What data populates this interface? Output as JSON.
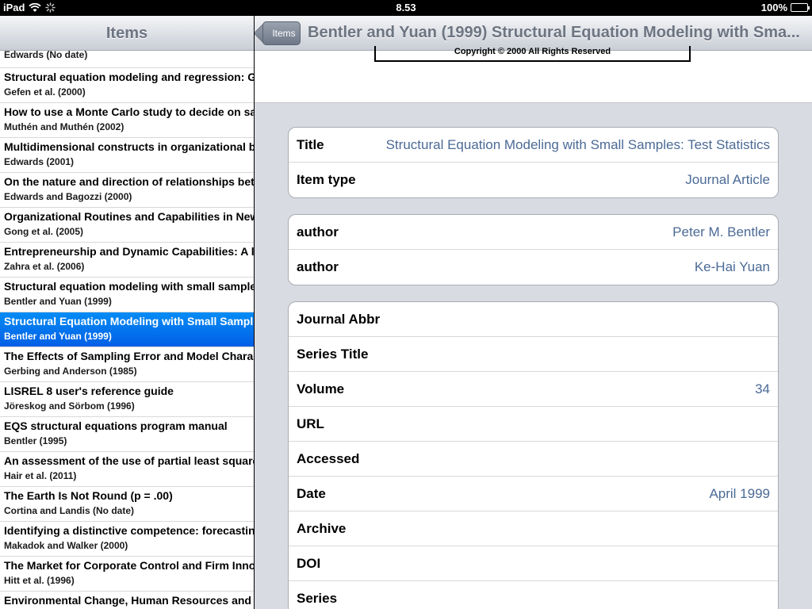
{
  "status_bar": {
    "device": "iPad",
    "time": "8.53",
    "battery": "100%"
  },
  "left_pane": {
    "title": "Items",
    "items": [
      {
        "title": "",
        "subtitle": "Edwards (No date)",
        "selected": false
      },
      {
        "title": "Structural equation modeling and regression: G",
        "subtitle": "Gefen et al. (2000)",
        "selected": false
      },
      {
        "title": "How to use a Monte Carlo study to decide on sa",
        "subtitle": "Muthén and Muthén (2002)",
        "selected": false
      },
      {
        "title": "Multidimensional constructs in organizational b",
        "subtitle": "Edwards (2001)",
        "selected": false
      },
      {
        "title": "On the nature and direction of relationships bet",
        "subtitle": "Edwards and Bagozzi (2000)",
        "selected": false
      },
      {
        "title": "Organizational Routines and Capabilities in New",
        "subtitle": "Gong et al. (2005)",
        "selected": false
      },
      {
        "title": "Entrepreneurship and Dynamic Capabilities: A l",
        "subtitle": "Zahra et al. (2006)",
        "selected": false
      },
      {
        "title": "Structural equation modeling with small sample",
        "subtitle": "Bentler and Yuan (1999)",
        "selected": false
      },
      {
        "title": "Structural Equation Modeling with Small Sampl",
        "subtitle": "Bentler and Yuan (1999)",
        "selected": true
      },
      {
        "title": "The Effects of Sampling Error and Model Chara",
        "subtitle": "Gerbing and Anderson (1985)",
        "selected": false
      },
      {
        "title": "LISREL 8 user's reference guide",
        "subtitle": "Jöreskog and Sörbom (1996)",
        "selected": false
      },
      {
        "title": "EQS structural equations program manual",
        "subtitle": "Bentler (1995)",
        "selected": false
      },
      {
        "title": "An assessment of the use of partial least square",
        "subtitle": "Hair et al. (2011)",
        "selected": false
      },
      {
        "title": "The Earth Is Not Round (p = .00)",
        "subtitle": "Cortina and Landis (No date)",
        "selected": false
      },
      {
        "title": "Identifying a distinctive competence: forecastin",
        "subtitle": "Makadok and Walker (2000)",
        "selected": false
      },
      {
        "title": "The Market for Corporate Control and Firm Inno",
        "subtitle": "Hitt et al. (1996)",
        "selected": false
      },
      {
        "title": "Environmental Change, Human Resources and",
        "subtitle": "",
        "selected": false
      }
    ]
  },
  "right_pane": {
    "back_label": "Items",
    "title": "Bentler and Yuan (1999) Structural Equation Modeling with Sma...",
    "preview_text": "Copyright © 2000 All Rights Reserved",
    "groups": [
      [
        {
          "label": "Title",
          "value": "Structural Equation Modeling with Small Samples: Test Statistics"
        },
        {
          "label": "Item type",
          "value": "Journal Article"
        }
      ],
      [
        {
          "label": "author",
          "value": "Peter M. Bentler"
        },
        {
          "label": "author",
          "value": "Ke-Hai Yuan"
        }
      ],
      [
        {
          "label": "Journal Abbr",
          "value": ""
        },
        {
          "label": "Series Title",
          "value": ""
        },
        {
          "label": "Volume",
          "value": "34"
        },
        {
          "label": "URL",
          "value": ""
        },
        {
          "label": "Accessed",
          "value": ""
        },
        {
          "label": "Date",
          "value": "April 1999"
        },
        {
          "label": "Archive",
          "value": ""
        },
        {
          "label": "DOI",
          "value": ""
        },
        {
          "label": "Series",
          "value": ""
        }
      ]
    ]
  }
}
